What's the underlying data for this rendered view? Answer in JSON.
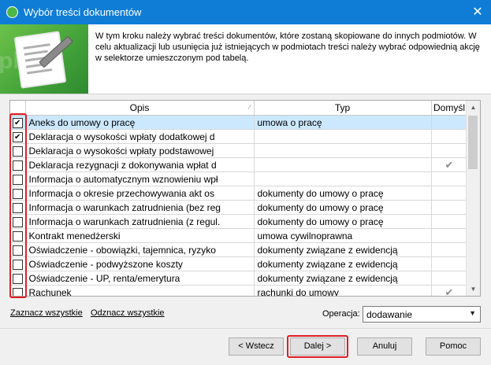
{
  "window": {
    "title": "Wybór treści dokumentów",
    "close_label": "✕"
  },
  "header": {
    "description": "W tym kroku należy wybrać treści dokumentów, które zostaną skopiowane do innych podmiotów. W celu aktualizacji lub usunięcia już istniejących w podmiotach treści należy wybrać odpowiednią akcję w selektorze umieszczonym pod tabelą.",
    "watermark": "pl"
  },
  "grid": {
    "columns": {
      "opis": "Opis",
      "typ": "Typ",
      "domysl": "Domyśl"
    },
    "rows": [
      {
        "checked": true,
        "opis": "Aneks do umowy o pracę",
        "typ": "umowa o pracę",
        "default": false,
        "selected": true
      },
      {
        "checked": true,
        "opis": "Deklaracja o wysokości wpłaty dodatkowej d",
        "typ": "",
        "default": false
      },
      {
        "checked": false,
        "opis": "Deklaracja o wysokości wpłaty podstawowej",
        "typ": "",
        "default": false
      },
      {
        "checked": false,
        "opis": "Deklaracja rezygnacji z dokonywania wpłat d",
        "typ": "",
        "default": true
      },
      {
        "checked": false,
        "opis": "Informacja o automatycznym wznowieniu wpł",
        "typ": "",
        "default": false
      },
      {
        "checked": false,
        "opis": "Informacja o okresie przechowywania akt os",
        "typ": "dokumenty do umowy o pracę",
        "default": false
      },
      {
        "checked": false,
        "opis": "Informacja o warunkach zatrudnienia (bez reg",
        "typ": "dokumenty do umowy o pracę",
        "default": false
      },
      {
        "checked": false,
        "opis": "Informacja o warunkach zatrudnienia (z regul.",
        "typ": "dokumenty do umowy o pracę",
        "default": false
      },
      {
        "checked": false,
        "opis": "Kontrakt menedżerski",
        "typ": "umowa cywilnoprawna",
        "default": false
      },
      {
        "checked": false,
        "opis": "Oświadczenie - obowiązki, tajemnica, ryzyko",
        "typ": "dokumenty związane z ewidencją",
        "default": false
      },
      {
        "checked": false,
        "opis": "Oświadczenie - podwyższone koszty",
        "typ": "dokumenty związane z ewidencją",
        "default": false
      },
      {
        "checked": false,
        "opis": "Oświadczenie - UP, renta/emerytura",
        "typ": "dokumenty związane z ewidencją",
        "default": false
      },
      {
        "checked": false,
        "opis": "Rachunek",
        "typ": "rachunki do umowy",
        "default": true
      }
    ],
    "tick_glyph": "✔"
  },
  "links": {
    "select_all": "Zaznacz wszystkie",
    "deselect_all": "Odznacz wszystkie"
  },
  "operation": {
    "label": "Operacja:",
    "value": "dodawanie"
  },
  "buttons": {
    "back": "< Wstecz",
    "next": "Dalej >",
    "cancel": "Anuluj",
    "help": "Pomoc"
  },
  "colors": {
    "titlebar": "#0f7dd6",
    "selection": "#cce8ff",
    "highlight": "#e01f26",
    "banner": "#45a43a"
  }
}
